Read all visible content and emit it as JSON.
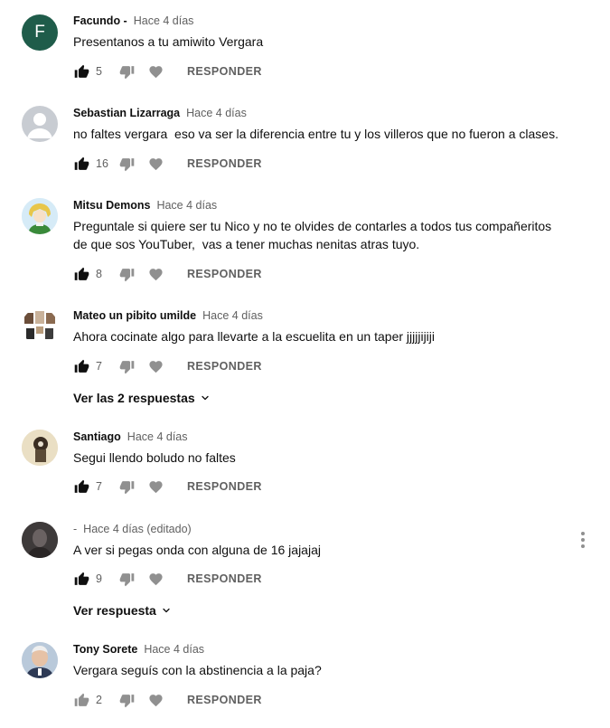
{
  "colors": {
    "avatar_facundo": "#1f5c4a",
    "avatar_sebastian": "#c8ccd2",
    "icon_gray": "#909090",
    "text_secondary": "#606060"
  },
  "icons": {
    "like": "thumbs-up-icon",
    "dislike": "thumbs-down-icon",
    "heart": "heart-icon",
    "menu": "more-vert-icon",
    "chevron": "chevron-down-icon"
  },
  "comments": [
    {
      "author": "Facundo -",
      "time": "Hace 4 días",
      "avatar_letter": "F",
      "text": "Presentanos a tu amiwito Vergara",
      "likes": "5",
      "reply_label": "RESPONDER"
    },
    {
      "author": "Sebastian Lizarraga",
      "time": "Hace 4 días",
      "text": "no faltes vergara  eso va ser la diferencia entre tu y los villeros que no fueron a clases.",
      "likes": "16",
      "reply_label": "RESPONDER"
    },
    {
      "author": "Mitsu Demons",
      "time": "Hace 4 días",
      "text": "Preguntale si quiere ser tu Nico y no te olvides de contarles a todos tus compañeritos\nde que sos YouTuber,  vas a tener muchas nenitas atras tuyo.",
      "likes": "8",
      "reply_label": "RESPONDER"
    },
    {
      "author": "Mateo un pibito umilde",
      "time": "Hace 4 días",
      "text": "Ahora cocinate algo para llevarte a la escuelita en un taper jjjjjijiji",
      "likes": "7",
      "reply_label": "RESPONDER",
      "view_replies": "Ver las 2 respuestas"
    },
    {
      "author": "Santiago",
      "time": "Hace 4 días",
      "text": "Segui llendo boludo no faltes",
      "likes": "7",
      "reply_label": "RESPONDER"
    },
    {
      "author": "-",
      "time": "Hace 4 días (editado)",
      "text": "A ver si pegas onda con alguna de 16 jajajaj",
      "likes": "9",
      "reply_label": "RESPONDER",
      "view_replies": "Ver respuesta"
    },
    {
      "author": "Tony Sorete",
      "time": "Hace 4 días",
      "text": "Vergara seguís con la abstinencia a la paja?",
      "likes": "2",
      "reply_label": "RESPONDER"
    }
  ]
}
